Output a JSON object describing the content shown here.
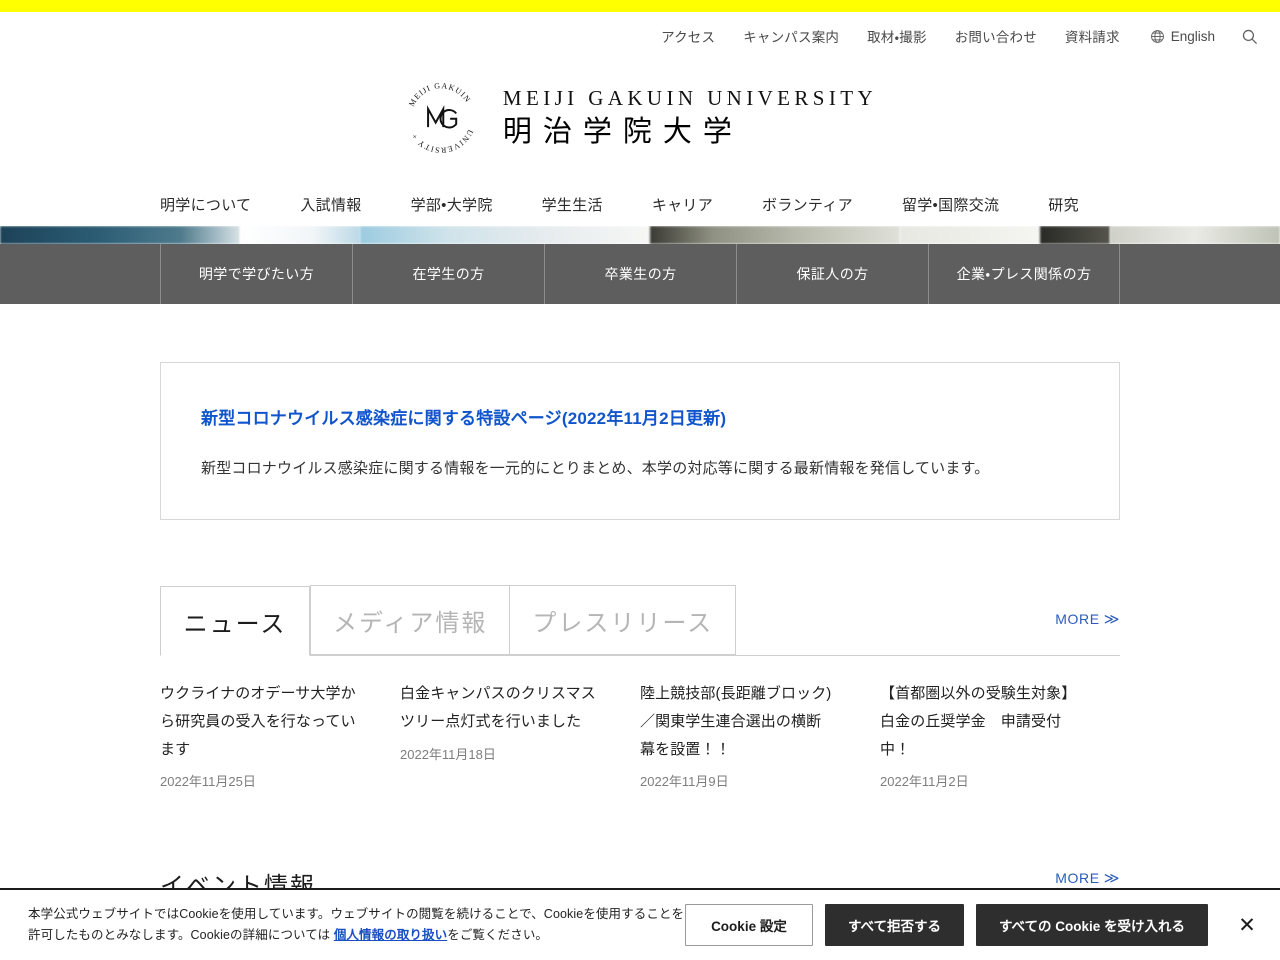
{
  "theme": {
    "accent_yellow": "#ffff00",
    "link_blue": "#1155cc",
    "more_blue": "#2b5cb8",
    "audience_bar_gray": "#5e5e5e",
    "dark_button": "#2e2e2e"
  },
  "utility_nav": {
    "links": [
      {
        "label": "アクセス"
      },
      {
        "label": "キャンパス案内"
      },
      {
        "label": "取材・撮影"
      },
      {
        "label": "お問い合わせ"
      },
      {
        "label": "資料請求"
      }
    ],
    "language": {
      "label": "English",
      "icon": "globe-icon"
    },
    "search": {
      "icon": "search-icon"
    }
  },
  "logo": {
    "seal_text": "MEIJI GAKUIN + UNIVERSITY",
    "monogram": "MG",
    "wordmark_en": "MEIJI GAKUIN UNIVERSITY",
    "wordmark_ja": "明治学院大学"
  },
  "main_nav": {
    "items": [
      {
        "label": "明学について"
      },
      {
        "label": "入試情報"
      },
      {
        "label": "学部•大学院"
      },
      {
        "label": "学生生活"
      },
      {
        "label": "キャリア"
      },
      {
        "label": "ボランティア"
      },
      {
        "label": "留学•国際交流"
      },
      {
        "label": "研究"
      }
    ]
  },
  "audience_bar": {
    "items": [
      {
        "label": "明学で学びたい方"
      },
      {
        "label": "在学生の方"
      },
      {
        "label": "卒業生の方"
      },
      {
        "label": "保証人の方"
      },
      {
        "label": "企業・プレス関係の方"
      }
    ]
  },
  "notice": {
    "title": "新型コロナウイルス感染症に関する特設ページ(2022年11月2日更新)",
    "body": "新型コロナウイルス感染症に関する情報を一元的にとりまとめ、本学の対応等に関する最新情報を発信しています。"
  },
  "news": {
    "tabs": [
      {
        "label": "ニュース",
        "active": true
      },
      {
        "label": "メディア情報",
        "active": false
      },
      {
        "label": "プレスリリース",
        "active": false
      }
    ],
    "more_label": "MORE",
    "more_chevron": "≫",
    "items": [
      {
        "title": "ウクライナのオデーサ大学から研究員の受入を行なっています",
        "date": "2022年11月25日"
      },
      {
        "title": "白金キャンパスのクリスマスツリー点灯式を行いました",
        "date": "2022年11月18日"
      },
      {
        "title": "陸上競技部(長距離ブロック)／関東学生連合選出の横断幕を設置！！",
        "date": "2022年11月9日"
      },
      {
        "title": "【首都圏以外の受験生対象】白金の丘奨学金　申請受付中！",
        "date": "2022年11月2日"
      }
    ]
  },
  "next_section": {
    "heading": "イベント情報",
    "more_label": "MORE",
    "more_chevron": "≫"
  },
  "cookie_banner": {
    "text_before": "本学公式ウェブサイトではCookieを使用しています。ウェブサイトの閲覧を続けることで、Cookieを使用することを許可したものとみなします。Cookieの詳細については ",
    "link_label": "個人情報の取り扱い",
    "text_after": "をご覧ください。",
    "settings_label": "Cookie 設定",
    "reject_label": "すべて拒否する",
    "accept_label": "すべての Cookie を受け入れる",
    "close_glyph": "✕"
  }
}
